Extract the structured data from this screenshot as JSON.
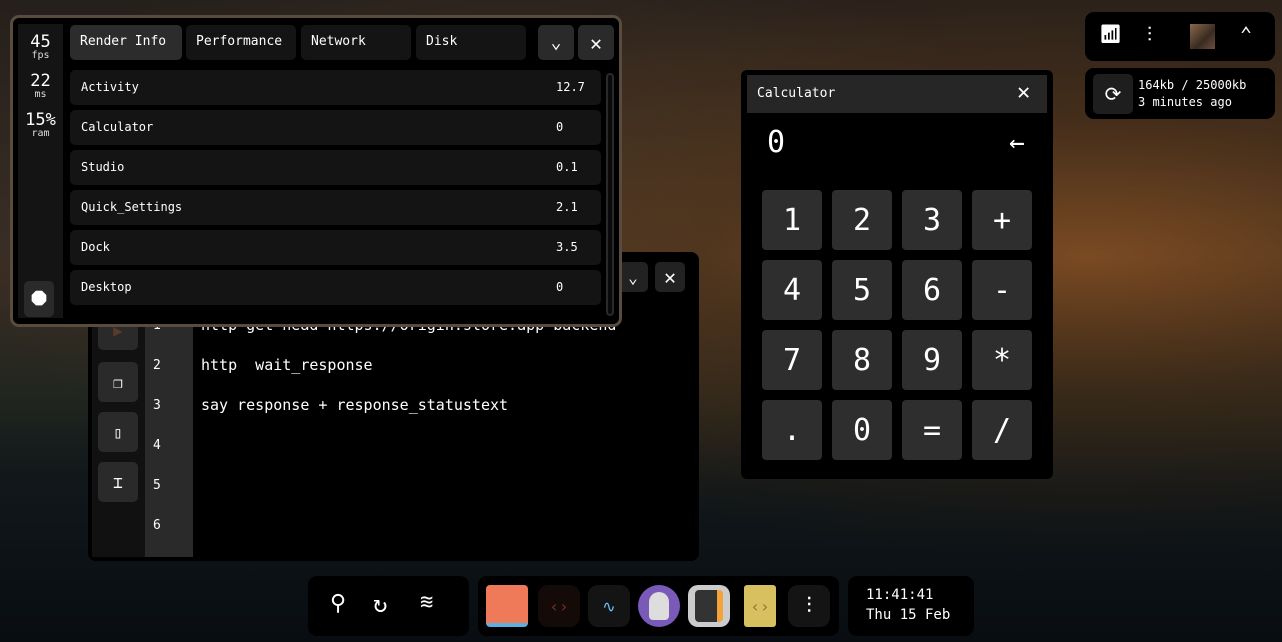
{
  "performance_window": {
    "stats": [
      {
        "value": "45",
        "unit": "fps"
      },
      {
        "value": "22",
        "unit": "ms"
      },
      {
        "value": "15%",
        "unit": "ram"
      }
    ],
    "tabs": [
      {
        "label": "Render Info",
        "active": true
      },
      {
        "label": "Performance"
      },
      {
        "label": "Network"
      },
      {
        "label": "Disk"
      }
    ],
    "rows": [
      {
        "name": "Activity",
        "value": "12.7"
      },
      {
        "name": "Calculator",
        "value": "0"
      },
      {
        "name": "Studio",
        "value": "0.1"
      },
      {
        "name": "Quick_Settings",
        "value": "2.1"
      },
      {
        "name": "Dock",
        "value": "3.5"
      },
      {
        "name": "Desktop",
        "value": "0"
      }
    ]
  },
  "editor": {
    "line_numbers": [
      "1",
      "2",
      "3",
      "4",
      "5",
      "6"
    ],
    "lines": [
      "http get head https://origin.store.app backend",
      "http  wait_response",
      "say response + response_statustext"
    ]
  },
  "calculator": {
    "title": "Calculator",
    "display": "0",
    "keys": [
      "1",
      "2",
      "3",
      "+",
      "4",
      "5",
      "6",
      "-",
      "7",
      "8",
      "9",
      "*",
      ".",
      "0",
      "=",
      "/"
    ]
  },
  "tray": {
    "sync_usage": "164kb / 25000kb",
    "sync_time": "3 minutes ago"
  },
  "dock": {
    "time": "11:41:41",
    "date": "Thu 15 Feb"
  },
  "colors": {
    "accent_folder": "#ee7a5a",
    "calc_orange": "#f2a33a",
    "window_border": "#5a4b3f"
  }
}
